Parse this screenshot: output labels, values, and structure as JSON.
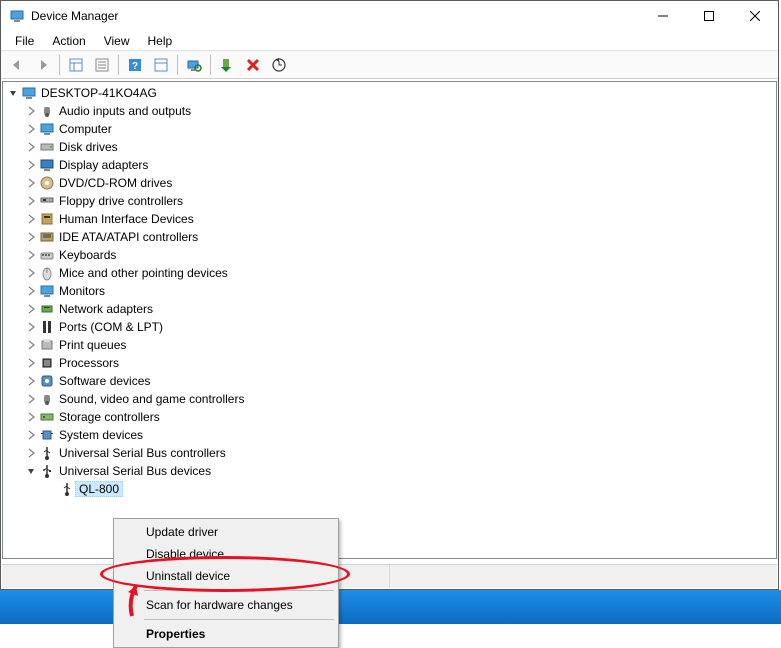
{
  "window": {
    "title": "Device Manager"
  },
  "menubar": {
    "file": "File",
    "action": "Action",
    "view": "View",
    "help": "Help"
  },
  "tree": {
    "root": "DESKTOP-41KO4AG",
    "categories": [
      {
        "label": "Audio inputs and outputs"
      },
      {
        "label": "Computer"
      },
      {
        "label": "Disk drives"
      },
      {
        "label": "Display adapters"
      },
      {
        "label": "DVD/CD-ROM drives"
      },
      {
        "label": "Floppy drive controllers"
      },
      {
        "label": "Human Interface Devices"
      },
      {
        "label": "IDE ATA/ATAPI controllers"
      },
      {
        "label": "Keyboards"
      },
      {
        "label": "Mice and other pointing devices"
      },
      {
        "label": "Monitors"
      },
      {
        "label": "Network adapters"
      },
      {
        "label": "Ports (COM & LPT)"
      },
      {
        "label": "Print queues"
      },
      {
        "label": "Processors"
      },
      {
        "label": "Software devices"
      },
      {
        "label": "Sound, video and game controllers"
      },
      {
        "label": "Storage controllers"
      },
      {
        "label": "System devices"
      },
      {
        "label": "Universal Serial Bus controllers"
      }
    ],
    "expanded_category": "Universal Serial Bus devices",
    "selected_device": "QL-800"
  },
  "context_menu": {
    "update": "Update driver",
    "disable": "Disable device",
    "uninstall": "Uninstall device",
    "scan": "Scan for hardware changes",
    "properties": "Properties"
  }
}
